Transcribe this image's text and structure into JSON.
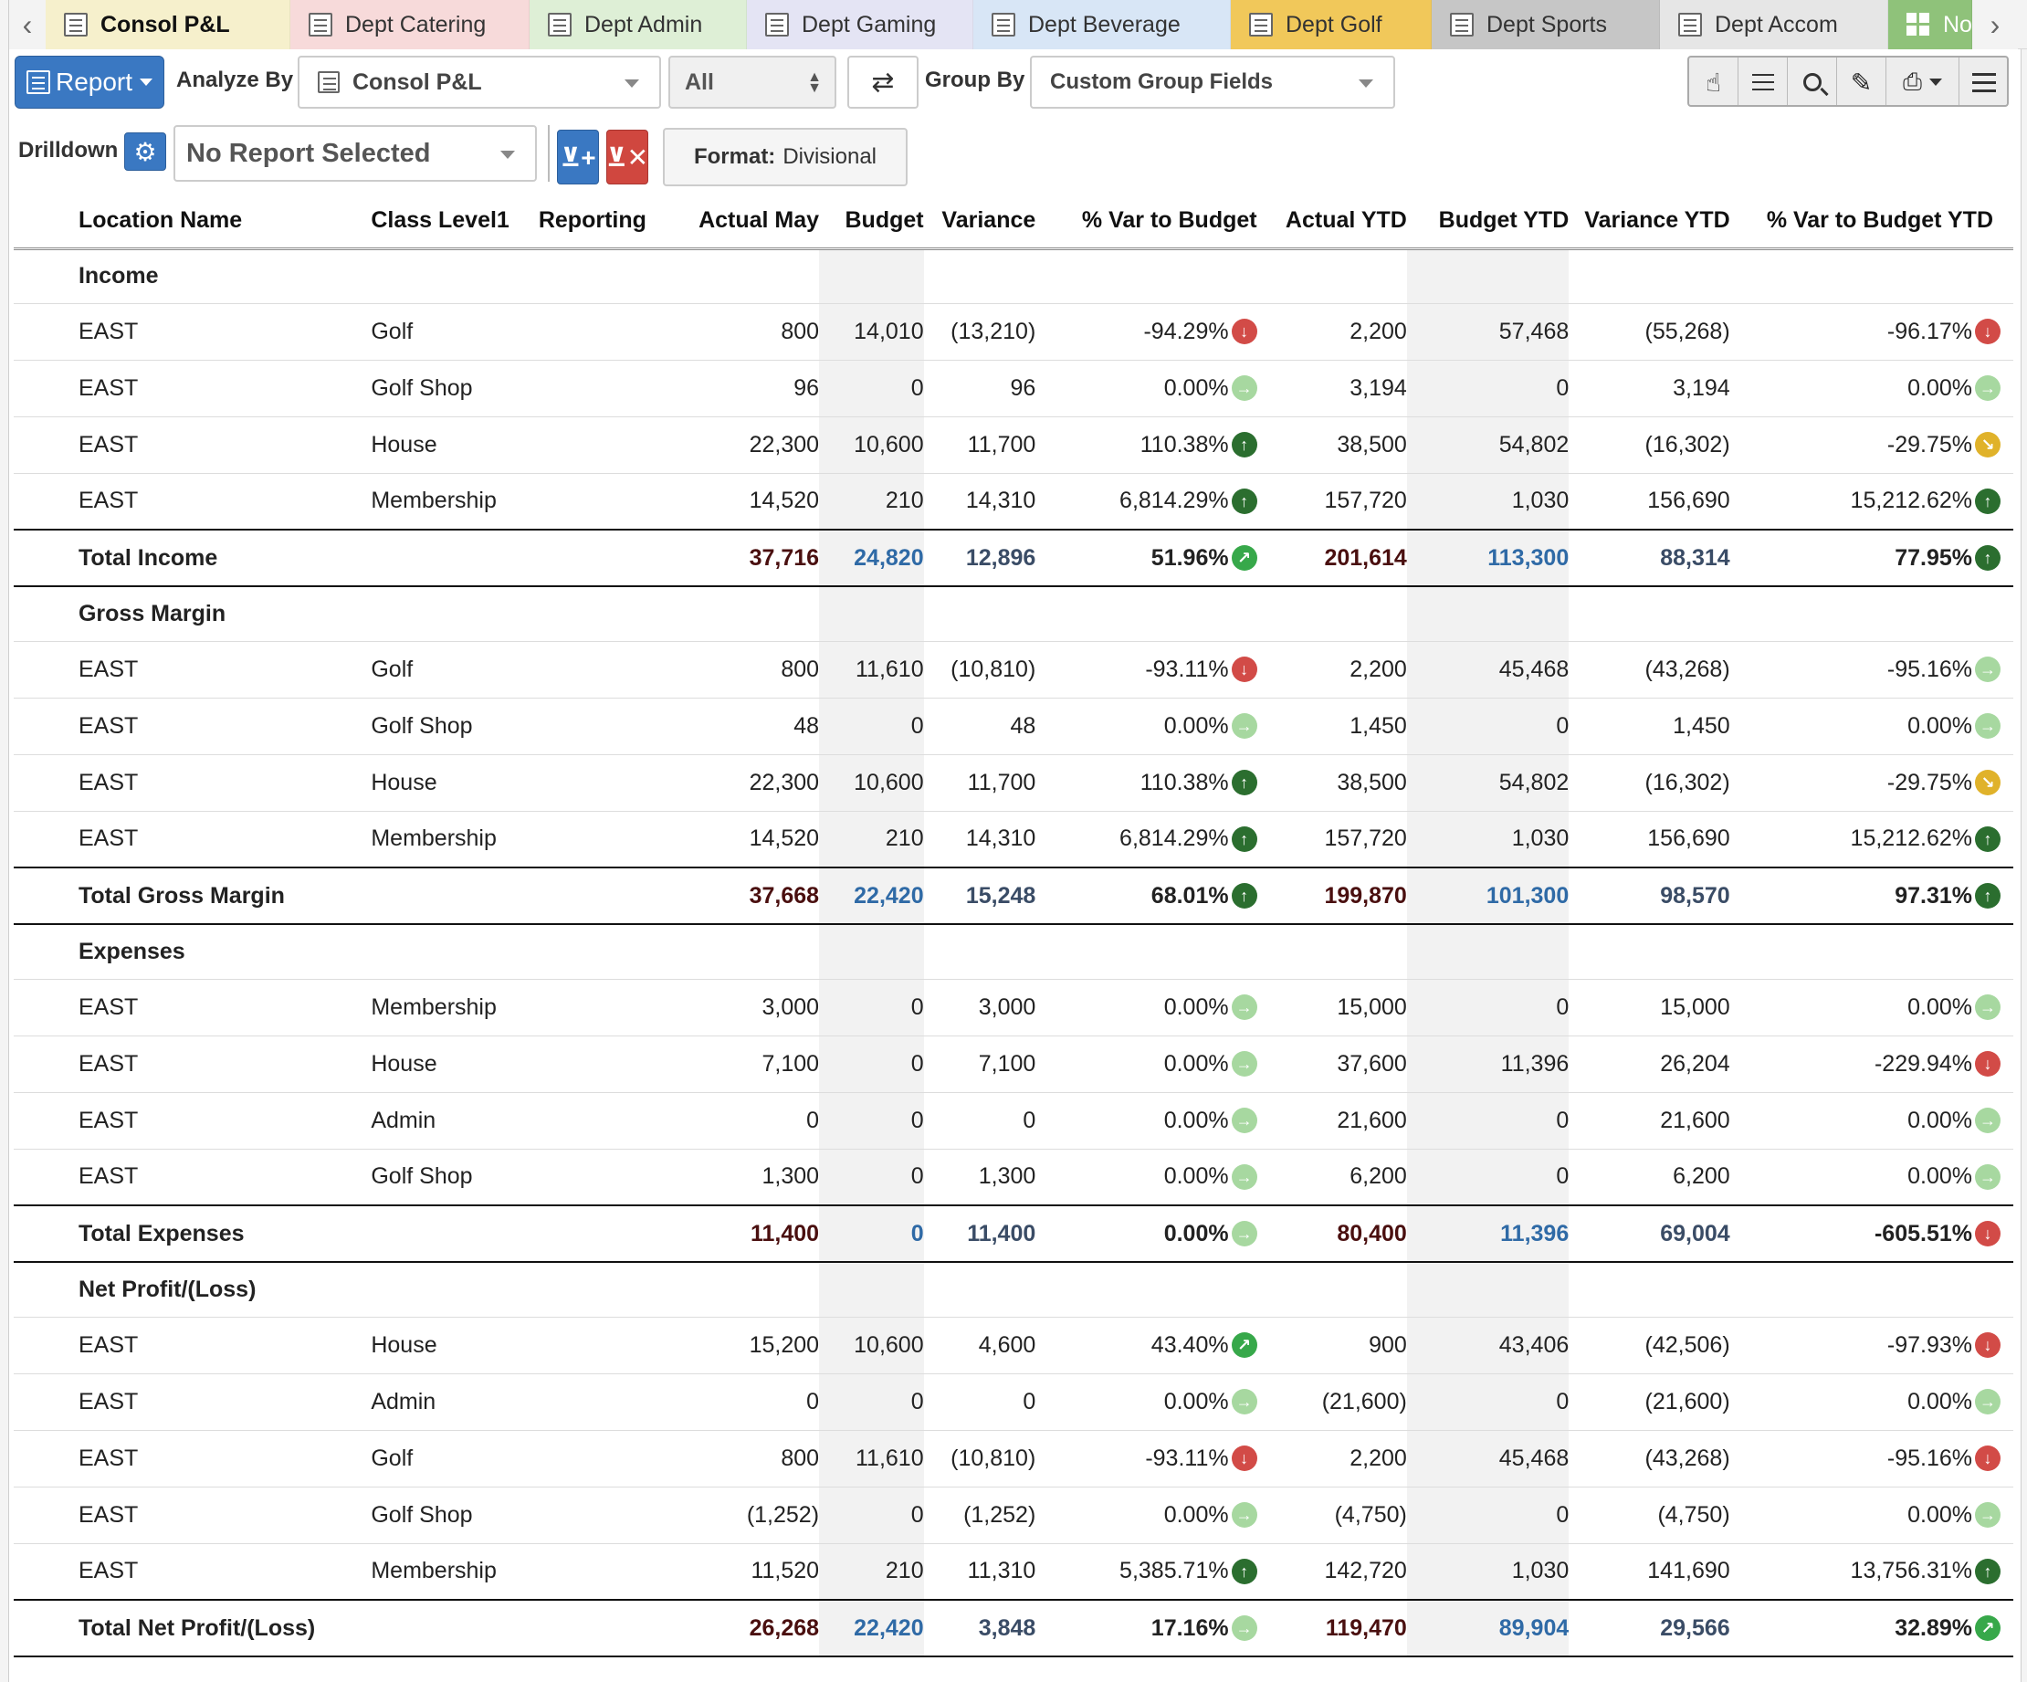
{
  "tabs": [
    {
      "label": "Consol P&L",
      "color": "#f6f0cc",
      "active": true,
      "icon": "list-icon"
    },
    {
      "label": "Dept Catering",
      "color": "#f7dada",
      "icon": "list-icon"
    },
    {
      "label": "Dept Admin",
      "color": "#deefd6",
      "icon": "list-icon"
    },
    {
      "label": "Dept Gaming",
      "color": "#e4e4f4",
      "icon": "list-icon"
    },
    {
      "label": "Dept Beverage",
      "color": "#d8e6f6",
      "icon": "list-icon"
    },
    {
      "label": "Dept Golf",
      "color": "#f1c85a",
      "icon": "list-icon"
    },
    {
      "label": "Dept Sports",
      "color": "#c6c6c6",
      "icon": "list-icon"
    },
    {
      "label": "Dept Accom",
      "color": "#e6e6e6",
      "icon": "list-icon"
    },
    {
      "label": "Note",
      "color": "#8fc27a",
      "icon": "grid-icon"
    }
  ],
  "toolbar": {
    "report_label": "Report",
    "analyze_by_label": "Analyze By",
    "analyze_by_value": "Consol P&L",
    "filter_value": "All",
    "group_by_label": "Group By",
    "group_by_value": "Custom Group Fields",
    "drilldown_label": "Drilldown",
    "drilldown_report": "No Report Selected",
    "format_label": "Format:",
    "format_value": "Divisional"
  },
  "table": {
    "columns": [
      "Location Name",
      "Class Level1",
      "Reporting",
      "Actual May",
      "Budget",
      "Variance",
      "% Var to Budget",
      "Actual YTD",
      "Budget YTD",
      "Variance YTD",
      "% Var to Budget YTD"
    ],
    "sections": [
      {
        "header": "Income",
        "rows": [
          {
            "loc": "EAST",
            "cls": "Golf",
            "actual": "800",
            "budget": "14,010",
            "variance": "(13,210)",
            "pct": "-94.29%",
            "pct_arrow": "down",
            "ytd": "2,200",
            "bytd": "57,468",
            "vytd": "(55,268)",
            "pytd": "-96.17%",
            "pytd_arrow": "down"
          },
          {
            "loc": "EAST",
            "cls": "Golf Shop",
            "actual": "96",
            "budget": "0",
            "variance": "96",
            "pct": "0.00%",
            "pct_arrow": "right",
            "ytd": "3,194",
            "bytd": "0",
            "vytd": "3,194",
            "pytd": "0.00%",
            "pytd_arrow": "right"
          },
          {
            "loc": "EAST",
            "cls": "House",
            "actual": "22,300",
            "budget": "10,600",
            "variance": "11,700",
            "pct": "110.38%",
            "pct_arrow": "up",
            "ytd": "38,500",
            "bytd": "54,802",
            "vytd": "(16,302)",
            "pytd": "-29.75%",
            "pytd_arrow": "downright"
          },
          {
            "loc": "EAST",
            "cls": "Membership",
            "actual": "14,520",
            "budget": "210",
            "variance": "14,310",
            "pct": "6,814.29%",
            "pct_arrow": "up",
            "ytd": "157,720",
            "bytd": "1,030",
            "vytd": "156,690",
            "pytd": "15,212.62%",
            "pytd_arrow": "up"
          }
        ],
        "total": {
          "label": "Total Income",
          "actual": "37,716",
          "budget": "24,820",
          "variance": "12,896",
          "pct": "51.96%",
          "pct_arrow": "upright",
          "ytd": "201,614",
          "bytd": "113,300",
          "vytd": "88,314",
          "pytd": "77.95%",
          "pytd_arrow": "up"
        }
      },
      {
        "header": "Gross Margin",
        "rows": [
          {
            "loc": "EAST",
            "cls": "Golf",
            "actual": "800",
            "budget": "11,610",
            "variance": "(10,810)",
            "pct": "-93.11%",
            "pct_arrow": "down",
            "ytd": "2,200",
            "bytd": "45,468",
            "vytd": "(43,268)",
            "pytd": "-95.16%",
            "pytd_arrow": "right"
          },
          {
            "loc": "EAST",
            "cls": "Golf Shop",
            "actual": "48",
            "budget": "0",
            "variance": "48",
            "pct": "0.00%",
            "pct_arrow": "right",
            "ytd": "1,450",
            "bytd": "0",
            "vytd": "1,450",
            "pytd": "0.00%",
            "pytd_arrow": "right"
          },
          {
            "loc": "EAST",
            "cls": "House",
            "actual": "22,300",
            "budget": "10,600",
            "variance": "11,700",
            "pct": "110.38%",
            "pct_arrow": "up",
            "ytd": "38,500",
            "bytd": "54,802",
            "vytd": "(16,302)",
            "pytd": "-29.75%",
            "pytd_arrow": "downright"
          },
          {
            "loc": "EAST",
            "cls": "Membership",
            "actual": "14,520",
            "budget": "210",
            "variance": "14,310",
            "pct": "6,814.29%",
            "pct_arrow": "up",
            "ytd": "157,720",
            "bytd": "1,030",
            "vytd": "156,690",
            "pytd": "15,212.62%",
            "pytd_arrow": "up"
          }
        ],
        "total": {
          "label": "Total Gross Margin",
          "actual": "37,668",
          "budget": "22,420",
          "variance": "15,248",
          "pct": "68.01%",
          "pct_arrow": "up",
          "ytd": "199,870",
          "bytd": "101,300",
          "vytd": "98,570",
          "pytd": "97.31%",
          "pytd_arrow": "up"
        }
      },
      {
        "header": "Expenses",
        "rows": [
          {
            "loc": "EAST",
            "cls": "Membership",
            "actual": "3,000",
            "budget": "0",
            "variance": "3,000",
            "pct": "0.00%",
            "pct_arrow": "right",
            "ytd": "15,000",
            "bytd": "0",
            "vytd": "15,000",
            "pytd": "0.00%",
            "pytd_arrow": "right"
          },
          {
            "loc": "EAST",
            "cls": "House",
            "actual": "7,100",
            "budget": "0",
            "variance": "7,100",
            "pct": "0.00%",
            "pct_arrow": "right",
            "ytd": "37,600",
            "bytd": "11,396",
            "vytd": "26,204",
            "pytd": "-229.94%",
            "pytd_arrow": "down"
          },
          {
            "loc": "EAST",
            "cls": "Admin",
            "actual": "0",
            "budget": "0",
            "variance": "0",
            "pct": "0.00%",
            "pct_arrow": "right",
            "ytd": "21,600",
            "bytd": "0",
            "vytd": "21,600",
            "pytd": "0.00%",
            "pytd_arrow": "right"
          },
          {
            "loc": "EAST",
            "cls": "Golf Shop",
            "actual": "1,300",
            "budget": "0",
            "variance": "1,300",
            "pct": "0.00%",
            "pct_arrow": "right",
            "ytd": "6,200",
            "bytd": "0",
            "vytd": "6,200",
            "pytd": "0.00%",
            "pytd_arrow": "right"
          }
        ],
        "total": {
          "label": "Total Expenses",
          "actual": "11,400",
          "budget": "0",
          "variance": "11,400",
          "pct": "0.00%",
          "pct_arrow": "right",
          "ytd": "80,400",
          "bytd": "11,396",
          "vytd": "69,004",
          "pytd": "-605.51%",
          "pytd_arrow": "down"
        }
      },
      {
        "header": "Net Profit/(Loss)",
        "rows": [
          {
            "loc": "EAST",
            "cls": "House",
            "actual": "15,200",
            "budget": "10,600",
            "variance": "4,600",
            "pct": "43.40%",
            "pct_arrow": "upright",
            "ytd": "900",
            "bytd": "43,406",
            "vytd": "(42,506)",
            "pytd": "-97.93%",
            "pytd_arrow": "down"
          },
          {
            "loc": "EAST",
            "cls": "Admin",
            "actual": "0",
            "budget": "0",
            "variance": "0",
            "pct": "0.00%",
            "pct_arrow": "right",
            "ytd": "(21,600)",
            "bytd": "0",
            "vytd": "(21,600)",
            "pytd": "0.00%",
            "pytd_arrow": "right"
          },
          {
            "loc": "EAST",
            "cls": "Golf",
            "actual": "800",
            "budget": "11,610",
            "variance": "(10,810)",
            "pct": "-93.11%",
            "pct_arrow": "down",
            "ytd": "2,200",
            "bytd": "45,468",
            "vytd": "(43,268)",
            "pytd": "-95.16%",
            "pytd_arrow": "down"
          },
          {
            "loc": "EAST",
            "cls": "Golf Shop",
            "actual": "(1,252)",
            "budget": "0",
            "variance": "(1,252)",
            "pct": "0.00%",
            "pct_arrow": "right",
            "ytd": "(4,750)",
            "bytd": "0",
            "vytd": "(4,750)",
            "pytd": "0.00%",
            "pytd_arrow": "right"
          },
          {
            "loc": "EAST",
            "cls": "Membership",
            "actual": "11,520",
            "budget": "210",
            "variance": "11,310",
            "pct": "5,385.71%",
            "pct_arrow": "up",
            "ytd": "142,720",
            "bytd": "1,030",
            "vytd": "141,690",
            "pytd": "13,756.31%",
            "pytd_arrow": "up"
          }
        ],
        "total": {
          "label": "Total Net Profit/(Loss)",
          "actual": "26,268",
          "budget": "22,420",
          "variance": "3,848",
          "pct": "17.16%",
          "pct_arrow": "right",
          "ytd": "119,470",
          "bytd": "89,904",
          "vytd": "29,566",
          "pytd": "32.89%",
          "pytd_arrow": "upright"
        }
      }
    ]
  }
}
